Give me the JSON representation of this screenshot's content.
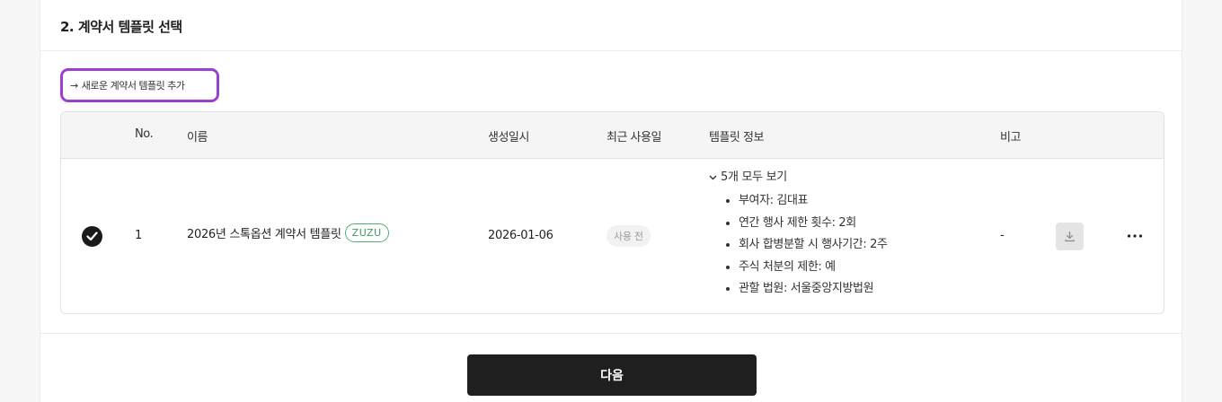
{
  "section": {
    "title": "2. 계약서 템플릿 선택"
  },
  "add_template": {
    "arrow": "→",
    "label": "새로운 계약서 템플릿 추가"
  },
  "table": {
    "headers": [
      "No.",
      "이름",
      "생성일시",
      "최근 사용일",
      "템플릿 정보",
      "비고"
    ],
    "rows": [
      {
        "selected": true,
        "no": "1",
        "name": "2026년 스톡옵션 계약서 템플릿",
        "badge": "ZUZU",
        "created": "2026-01-06",
        "last_used": "사용 전",
        "info_toggle": "5개 모두 보기",
        "info_items": [
          "부여자: 김대표",
          "연간 행사 제한 횟수: 2회",
          "회사 합병분할 시 행사기간: 2주",
          "주식 처분의 제한: 예",
          "관할 법원: 서울중앙지방법원"
        ],
        "note": "-"
      }
    ]
  },
  "icons": {
    "check": "checkmark-icon",
    "download": "download-icon",
    "more": "more-horizontal-icon",
    "chevron": "chevron-down-icon"
  },
  "colors": {
    "highlight": "#9b3fd0",
    "badge_green": "#4fae72",
    "primary_button": "#1f1f1f"
  },
  "footer": {
    "next_label": "다음"
  }
}
